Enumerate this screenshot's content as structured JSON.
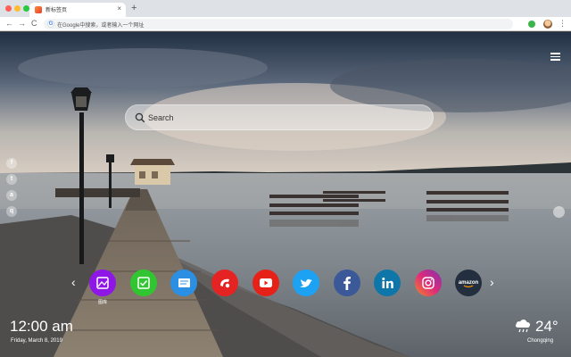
{
  "browser": {
    "tab_title": "新标签页",
    "tab_close": "×",
    "new_tab": "+",
    "back": "←",
    "forward": "→",
    "reload": "C",
    "omnibox_placeholder": "在Google中搜索，或者输入一个网址",
    "menu": "⋮"
  },
  "search": {
    "placeholder": "Search"
  },
  "side_share": [
    "f",
    "t",
    "a",
    "q"
  ],
  "dock": {
    "prev": "‹",
    "next": "›",
    "shortcuts": [
      {
        "name": "gallery",
        "label": "图库",
        "color": "#8f17e6"
      },
      {
        "name": "checklist",
        "label": "",
        "color": "#32c532"
      },
      {
        "name": "notes",
        "label": "",
        "color": "#2b8fe3"
      },
      {
        "name": "game",
        "label": "",
        "color": "#e62323"
      },
      {
        "name": "youtube",
        "label": "",
        "color": "#e62117"
      },
      {
        "name": "twitter",
        "label": "",
        "color": "#1da1f2"
      },
      {
        "name": "facebook",
        "label": "",
        "color": "#3b5998"
      },
      {
        "name": "linkedin",
        "label": "",
        "color": "#0e76a8"
      },
      {
        "name": "instagram",
        "label": "",
        "color": "#d62976"
      },
      {
        "name": "amazon",
        "label": "amazon",
        "color": "#232f3e"
      }
    ]
  },
  "clock": {
    "time": "12:00 am",
    "date": "Friday, March 8, 2019"
  },
  "weather": {
    "temp": "24°",
    "city": "Chongqing",
    "icon": "cloud-rain-icon"
  }
}
